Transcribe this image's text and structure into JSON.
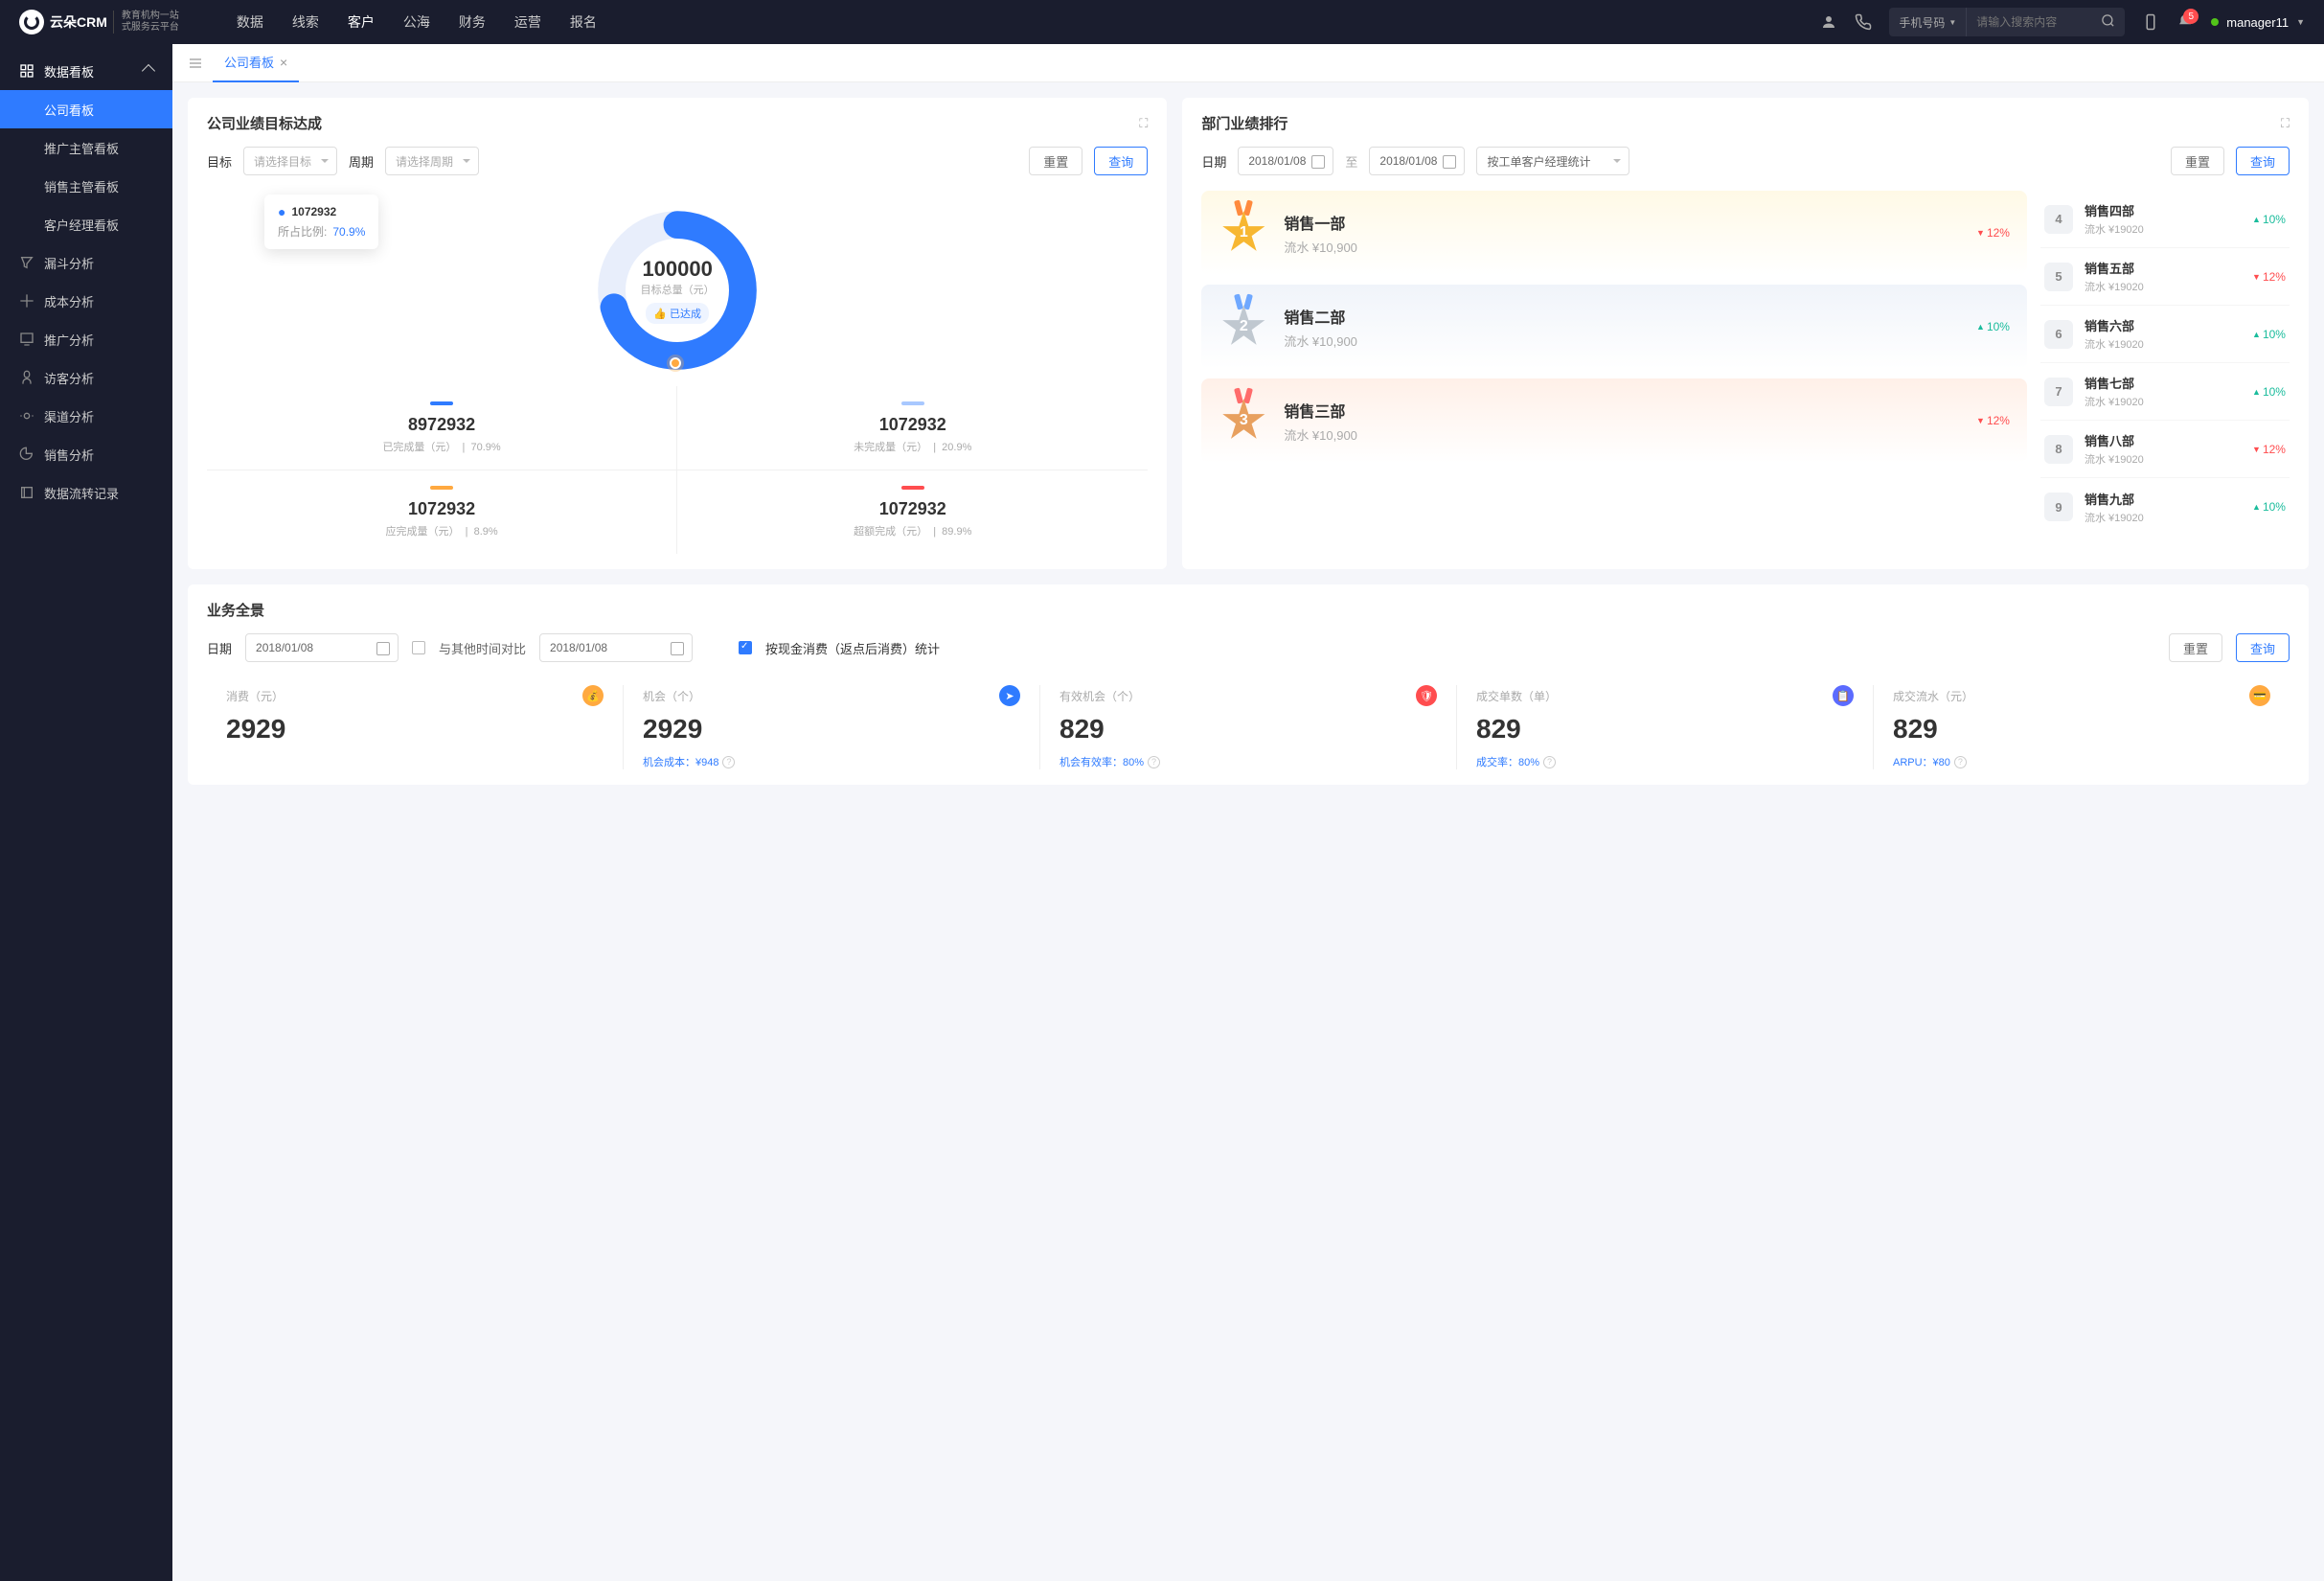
{
  "brand": {
    "name": "云朵CRM",
    "sub1": "教育机构一站",
    "sub2": "式服务云平台"
  },
  "topnav": [
    "数据",
    "线索",
    "客户",
    "公海",
    "财务",
    "运营",
    "报名"
  ],
  "topnav_active": 2,
  "search": {
    "type": "手机号码",
    "placeholder": "请输入搜索内容"
  },
  "notif_count": "5",
  "username": "manager11",
  "sidebar": {
    "header": "数据看板",
    "items": [
      "公司看板",
      "推广主管看板",
      "销售主管看板",
      "客户经理看板"
    ],
    "others": [
      "漏斗分析",
      "成本分析",
      "推广分析",
      "访客分析",
      "渠道分析",
      "销售分析",
      "数据流转记录"
    ]
  },
  "tab": {
    "label": "公司看板"
  },
  "panel1": {
    "title": "公司业绩目标达成",
    "target_label": "目标",
    "target_ph": "请选择目标",
    "period_label": "周期",
    "period_ph": "请选择周期",
    "reset": "重置",
    "query": "查询",
    "tooltip_val": "1072932",
    "tooltip_lbl": "所占比例:",
    "tooltip_pct": "70.9%",
    "center_val": "100000",
    "center_lbl": "目标总量（元）",
    "center_tag": "已达成",
    "stats": [
      {
        "bar": "#2f7bff",
        "val": "8972932",
        "lbl": "已完成量（元）",
        "pct": "70.9%"
      },
      {
        "bar": "#a8c8ff",
        "val": "1072932",
        "lbl": "未完成量（元）",
        "pct": "20.9%"
      },
      {
        "bar": "#ffa940",
        "val": "1072932",
        "lbl": "应完成量（元）",
        "pct": "8.9%"
      },
      {
        "bar": "#ff4d4f",
        "val": "1072932",
        "lbl": "超额完成（元）",
        "pct": "89.9%"
      }
    ]
  },
  "panel2": {
    "title": "部门业绩排行",
    "date_label": "日期",
    "date_from": "2018/01/08",
    "date_sep": "至",
    "date_to": "2018/01/08",
    "stat_sel": "按工单客户经理统计",
    "reset": "重置",
    "query": "查询",
    "top3": [
      {
        "name": "销售一部",
        "sub": "流水 ¥10,900",
        "pct": "12%",
        "dir": "up",
        "medal": "#f7b731",
        "ribbon": "#ff8a3d"
      },
      {
        "name": "销售二部",
        "sub": "流水 ¥10,900",
        "pct": "10%",
        "dir": "down",
        "medal": "#c0c8d0",
        "ribbon": "#6fa8ff"
      },
      {
        "name": "销售三部",
        "sub": "流水 ¥10,900",
        "pct": "12%",
        "dir": "up",
        "medal": "#e8a05f",
        "ribbon": "#ff6b6b"
      }
    ],
    "rest": [
      {
        "n": "4",
        "name": "销售四部",
        "sub": "流水 ¥19020",
        "pct": "10%",
        "dir": "down"
      },
      {
        "n": "5",
        "name": "销售五部",
        "sub": "流水 ¥19020",
        "pct": "12%",
        "dir": "up"
      },
      {
        "n": "6",
        "name": "销售六部",
        "sub": "流水 ¥19020",
        "pct": "10%",
        "dir": "down"
      },
      {
        "n": "7",
        "name": "销售七部",
        "sub": "流水 ¥19020",
        "pct": "10%",
        "dir": "down"
      },
      {
        "n": "8",
        "name": "销售八部",
        "sub": "流水 ¥19020",
        "pct": "12%",
        "dir": "up"
      },
      {
        "n": "9",
        "name": "销售九部",
        "sub": "流水 ¥19020",
        "pct": "10%",
        "dir": "down"
      }
    ]
  },
  "panel3": {
    "title": "业务全景",
    "date_label": "日期",
    "date1": "2018/01/08",
    "cmp_label": "与其他时间对比",
    "date2": "2018/01/08",
    "chk_label": "按现金消费（返点后消费）统计",
    "reset": "重置",
    "query": "查询",
    "metrics": [
      {
        "label": "消费（元）",
        "val": "2929",
        "foot": "",
        "icon": "#ffa940"
      },
      {
        "label": "机会（个）",
        "val": "2929",
        "foot": "机会成本：¥948",
        "icon": "#2f7bff"
      },
      {
        "label": "有效机会（个）",
        "val": "829",
        "foot": "机会有效率：80%",
        "icon": "#ff4d4f"
      },
      {
        "label": "成交单数（单）",
        "val": "829",
        "foot": "成交率：80%",
        "icon": "#5b6bff"
      },
      {
        "label": "成交流水（元）",
        "val": "829",
        "foot": "ARPU：¥80",
        "icon": "#ffa940"
      }
    ]
  },
  "chart_data": {
    "type": "pie",
    "title": "目标总量（元） 100000",
    "series": [
      {
        "name": "已完成量",
        "value": 70.9,
        "color": "#2f7bff"
      },
      {
        "name": "未完成量",
        "value": 29.1,
        "color": "#e8eefb"
      }
    ]
  }
}
